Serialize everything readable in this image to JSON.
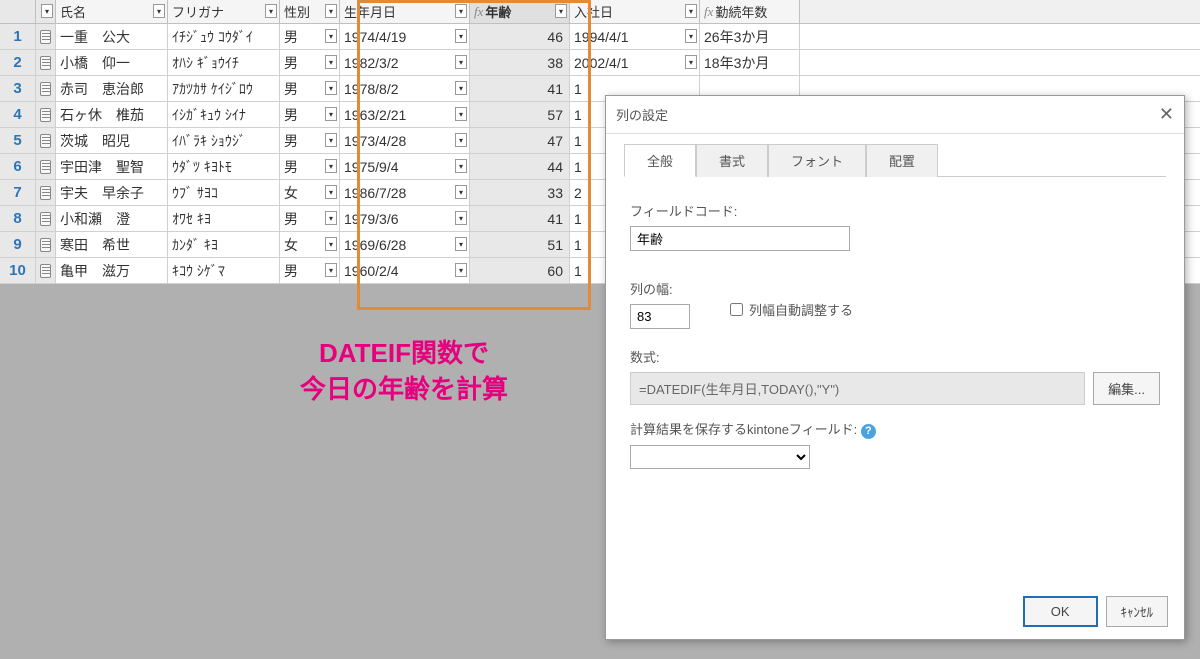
{
  "columns": {
    "name": "氏名",
    "kana": "フリガナ",
    "sex": "性別",
    "dob": "生年月日",
    "age": "年齢",
    "hire": "入社日",
    "tenure": "勤続年数"
  },
  "fx_prefix": "fx",
  "rows": [
    {
      "n": "1",
      "name": "一重　公大",
      "kana": "ｲﾁｼﾞｭｳ ｺｳﾀﾞｲ",
      "sex": "男",
      "dob": "1974/4/19",
      "age": "46",
      "hire": "1994/4/1",
      "ten": "26年3か月"
    },
    {
      "n": "2",
      "name": "小橋　仰一",
      "kana": "ｵﾊｼ ｷﾞｮｳｲﾁ",
      "sex": "男",
      "dob": "1982/3/2",
      "age": "38",
      "hire": "2002/4/1",
      "ten": "18年3か月"
    },
    {
      "n": "3",
      "name": "赤司　恵治郎",
      "kana": "ｱｶﾂｶｻ ｹｲｼﾞﾛｳ",
      "sex": "男",
      "dob": "1978/8/2",
      "age": "41",
      "hire": "1",
      "ten": ""
    },
    {
      "n": "4",
      "name": "石ヶ休　椎茄",
      "kana": "ｲｼｶﾞｷｭｳ ｼｲﾅ",
      "sex": "男",
      "dob": "1963/2/21",
      "age": "57",
      "hire": "1",
      "ten": ""
    },
    {
      "n": "5",
      "name": "茨城　昭児",
      "kana": "ｲﾊﾞﾗｷ ｼｮｳｼﾞ",
      "sex": "男",
      "dob": "1973/4/28",
      "age": "47",
      "hire": "1",
      "ten": ""
    },
    {
      "n": "6",
      "name": "宇田津　聖智",
      "kana": "ｳﾀﾞﾂ ｷﾖﾄﾓ",
      "sex": "男",
      "dob": "1975/9/4",
      "age": "44",
      "hire": "1",
      "ten": ""
    },
    {
      "n": "7",
      "name": "宇夫　早余子",
      "kana": "ｳﾌﾞ ｻﾖｺ",
      "sex": "女",
      "dob": "1986/7/28",
      "age": "33",
      "hire": "2",
      "ten": ""
    },
    {
      "n": "8",
      "name": "小和瀬　澄",
      "kana": "ｵﾜｾ ｷﾖ",
      "sex": "男",
      "dob": "1979/3/6",
      "age": "41",
      "hire": "1",
      "ten": ""
    },
    {
      "n": "9",
      "name": "寒田　希世",
      "kana": "ｶﾝﾀﾞ ｷﾖ",
      "sex": "女",
      "dob": "1969/6/28",
      "age": "51",
      "hire": "1",
      "ten": ""
    },
    {
      "n": "10",
      "name": "亀甲　滋万",
      "kana": "ｷｺｳ ｼｹﾞﾏ",
      "sex": "男",
      "dob": "1960/2/4",
      "age": "60",
      "hire": "1",
      "ten": ""
    }
  ],
  "annotation": {
    "line1": "DATEIF関数で",
    "line2": "今日の年齢を計算"
  },
  "dialog": {
    "title": "列の設定",
    "tabs": {
      "general": "全般",
      "format": "書式",
      "font": "フォント",
      "align": "配置"
    },
    "field_code_label": "フィールドコード:",
    "field_code_value": "年齢",
    "width_label": "列の幅:",
    "width_value": "83",
    "auto_width_label": "列幅自動調整する",
    "formula_label": "数式:",
    "formula_value": "=DATEDIF(生年月日,TODAY(),\"Y\")",
    "edit_btn": "編集...",
    "result_label": "計算結果を保存するkintoneフィールド:",
    "ok": "OK",
    "cancel": "ｷｬﾝｾﾙ"
  }
}
